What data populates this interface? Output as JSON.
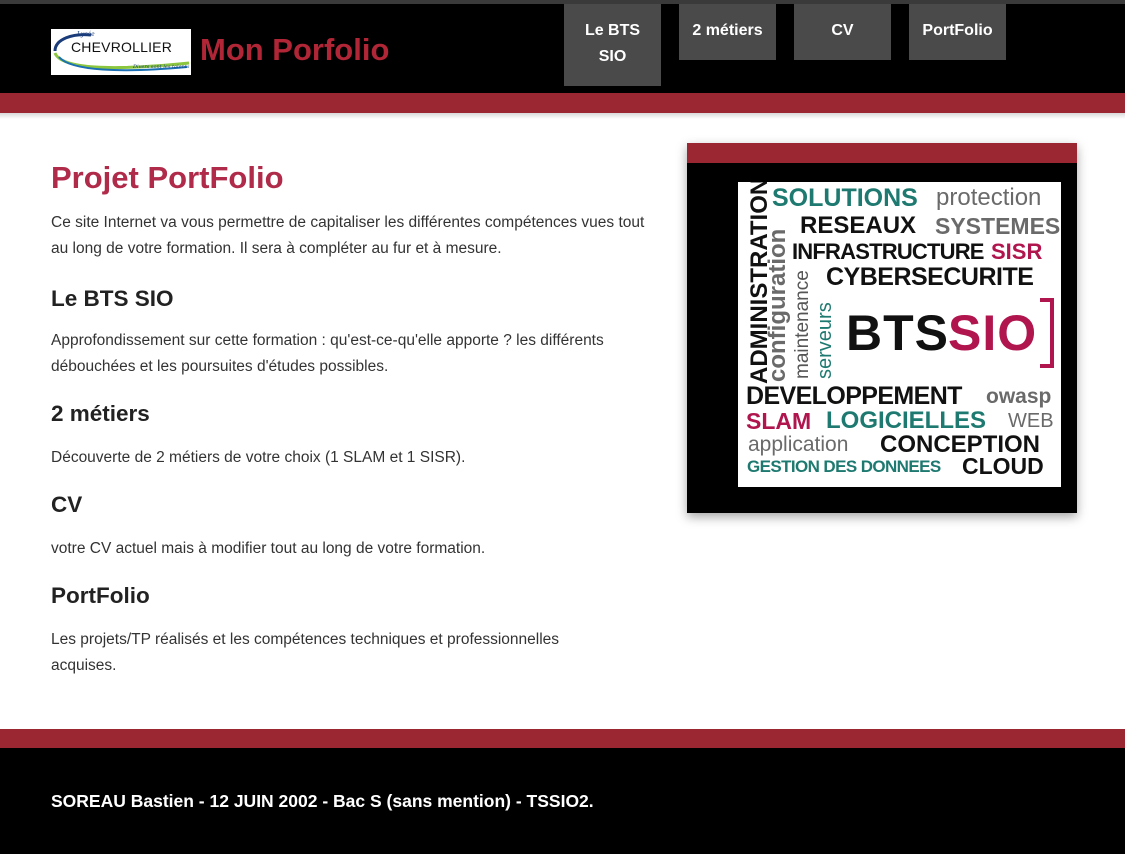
{
  "header": {
    "logo": {
      "small_text": "Lycée",
      "school_name": "CHEVROLLIER",
      "slogan": "Divers sont les talents"
    },
    "site_title": "Mon Porfolio"
  },
  "nav": {
    "items": [
      {
        "label": "Le BTS SIO"
      },
      {
        "label": "2 métiers"
      },
      {
        "label": "CV"
      },
      {
        "label": "PortFolio"
      }
    ]
  },
  "main": {
    "page_title": "Projet PortFolio",
    "intro": "Ce site Internet va vous permettre de capitaliser les différentes compétences vues tout au long de votre formation. Il sera à compléter au fur et à mesure.",
    "sections": [
      {
        "title": "Le BTS SIO",
        "text": "Approfondissement sur cette formation : qu'est-ce-qu'elle apporte ? les différents débouchées et les poursuites d'études possibles."
      },
      {
        "title": "2 métiers",
        "text": "Découverte de 2 métiers de votre choix (1 SLAM et 1 SISR)."
      },
      {
        "title": "CV",
        "text": "votre CV actuel mais à modifier tout au long de votre formation."
      },
      {
        "title": "PortFolio",
        "text": "Les projets/TP réalisés et les compétences techniques et professionnelles acquises."
      }
    ]
  },
  "word_cloud": {
    "words": {
      "solutions": "SOLUTIONS",
      "protection": "protection",
      "reseaux": "RESEAUX",
      "systemes": "SYSTEMES",
      "infrastructure": "INFRASTRUCTURE",
      "sisr": "SISR",
      "cybersecurite": "CYBERSECURITE",
      "administration": "ADMINISTRATION",
      "configuration": "configuration",
      "maintenance": "maintenance",
      "serveurs": "serveurs",
      "bts": "BTS",
      "sio": "SIO",
      "developpement": "DEVELOPPEMENT",
      "owasp": "owasp",
      "slam": "SLAM",
      "logicielles": "LOGICIELLES",
      "web": "WEB",
      "application": "application",
      "conception": "CONCEPTION",
      "gestion": "GESTION DES DONNEES",
      "cloud": "CLOUD"
    },
    "colors": {
      "teal": "#1e7a70",
      "crimson": "#b0154e",
      "black": "#111111",
      "grey": "#6a6a6a"
    }
  },
  "footer": {
    "text": "SOREAU Bastien - 12 JUIN 2002 - Bac S (sans mention) - TSSIO2."
  },
  "theme": {
    "accent_red": "#9b2733",
    "title_red": "#b02636",
    "nav_bg": "#4a4a4a",
    "header_bg": "#000000"
  }
}
